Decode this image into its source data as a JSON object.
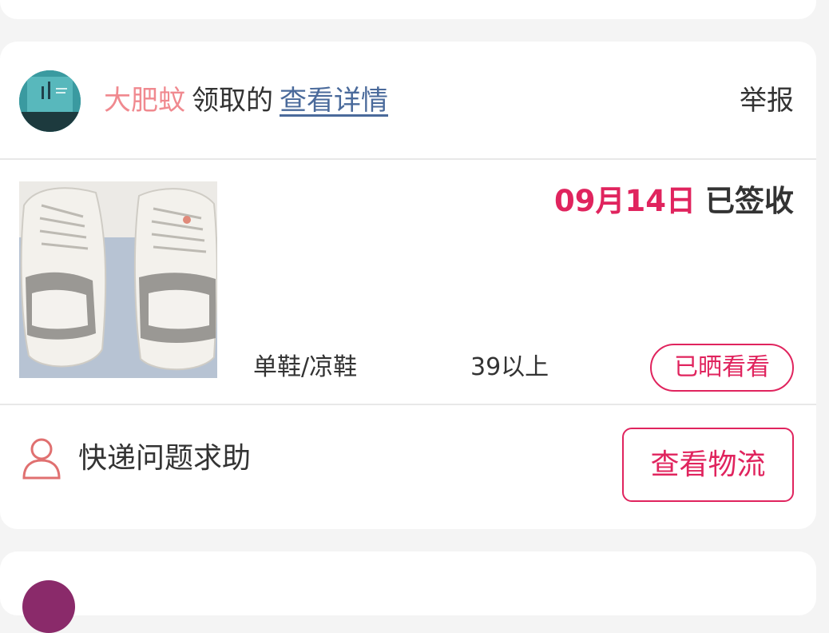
{
  "order": {
    "user": {
      "name": "大肥蚊",
      "action": "领取的",
      "details_link": "查看详情",
      "report": "举报"
    },
    "product": {
      "date": "09月14日",
      "status": "已签收",
      "category": "单鞋/凉鞋",
      "size": "39以上",
      "show_button": "已晒看看"
    },
    "actions": {
      "help_label": "快递问题求助",
      "logistics_button": "查看物流"
    }
  },
  "colors": {
    "accent": "#e0245e",
    "username": "#f0898f",
    "link": "#4a6a9b",
    "text": "#333333",
    "background": "#f4f4f4"
  },
  "icons": {
    "help": "person-icon"
  }
}
